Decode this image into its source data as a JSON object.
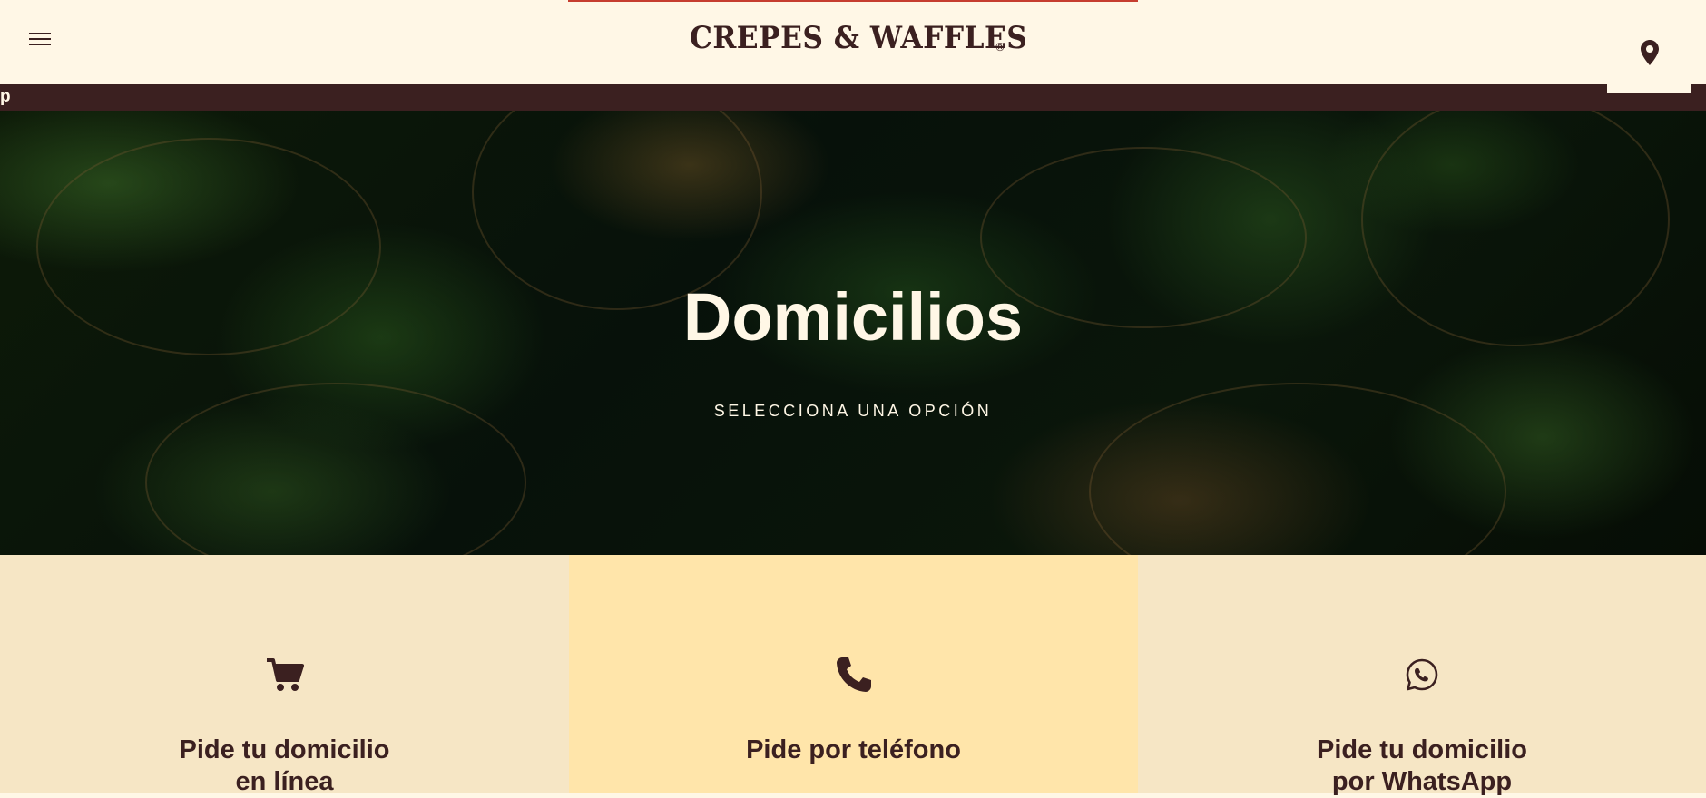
{
  "header": {
    "logo_text": "CREPES & WAFFLES",
    "logo_registered": "®",
    "menu_icon": "hamburger-menu-icon",
    "location_icon": "map-pin-icon"
  },
  "ticker": {
    "text": "p"
  },
  "hero": {
    "title": "Domicilios",
    "subtitle": "SELECCIONA UNA OPCIÓN"
  },
  "options": [
    {
      "icon": "shopping-cart-icon",
      "label": "Pide tu domicilio\nen línea"
    },
    {
      "icon": "phone-icon",
      "label": "Pide por teléfono"
    },
    {
      "icon": "whatsapp-icon",
      "label": "Pide tu domicilio\npor WhatsApp"
    }
  ],
  "colors": {
    "brand_brown": "#3b2020",
    "cream": "#fff7e6",
    "option_light": "#f6e6c5",
    "option_highlight": "#ffe5aa",
    "accent_red": "#c63d2f"
  }
}
